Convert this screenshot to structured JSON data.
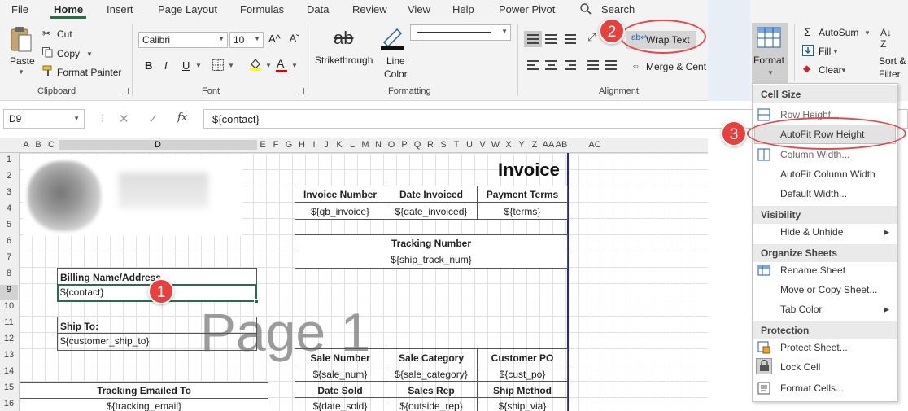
{
  "tabs": [
    "File",
    "Home",
    "Insert",
    "Page Layout",
    "Formulas",
    "Data",
    "Review",
    "View",
    "Help",
    "Power Pivot"
  ],
  "search": "Search",
  "clipboard": {
    "paste": "Paste",
    "cut": "Cut",
    "copy": "Copy",
    "format_painter": "Format Painter",
    "label": "Clipboard"
  },
  "font": {
    "name": "Calibri",
    "size": "10",
    "label": "Font",
    "bold": "B",
    "italic": "I",
    "underline": "U",
    "grow": "A^",
    "shrink": "Aˇ",
    "fill_color": "#ffff00",
    "font_color": "#e00000"
  },
  "formatting": {
    "strikethrough": "Strikethrough",
    "line_color": "Line\nColor",
    "label": "Formatting"
  },
  "alignment": {
    "wrap_text": "Wrap Text",
    "merge_center": "Merge & Cent",
    "label": "Alignment"
  },
  "cells": {
    "format": "Format"
  },
  "editing": {
    "autosum": "AutoSum",
    "fill": "Fill",
    "clear": "Clear",
    "sort_filter": "Sort &\nFilter"
  },
  "formula_bar": {
    "name_box": "D9",
    "content": "${contact}",
    "fx": "fx"
  },
  "columns": [
    "A",
    "B",
    "C",
    "D",
    "E",
    "F",
    "G",
    "H",
    "I",
    "J",
    "K",
    "L",
    "M",
    "N",
    "O",
    "P",
    "Q",
    "R",
    "S",
    "T",
    "U",
    "V",
    "W",
    "X",
    "Y",
    "Z",
    "AA",
    "AB",
    "AC"
  ],
  "rows": [
    "1",
    "2",
    "3",
    "4",
    "5",
    "6",
    "7",
    "8",
    "9",
    "10",
    "11",
    "12",
    "13",
    "14",
    "15",
    "16"
  ],
  "sheet": {
    "invoice_title": "Invoice",
    "invoice_number_label": "Invoice Number",
    "date_invoiced_label": "Date Invoiced",
    "payment_terms_label": "Payment Terms",
    "invoice_number_val": "${qb_invoice}",
    "date_invoiced_val": "${date_invoiced}",
    "payment_terms_val": "${terms}",
    "tracking_number_label": "Tracking Number",
    "tracking_number_val": "${ship_track_num}",
    "billing_label": "Billing Name/Address",
    "billing_val": "${contact}",
    "ship_to_label": "Ship To:",
    "ship_to_val": "${customer_ship_to}",
    "page_watermark": "Page 1",
    "sale_number_label": "Sale Number",
    "sale_category_label": "Sale Category",
    "customer_po_label": "Customer PO",
    "sale_number_val": "${sale_num}",
    "sale_category_val": "${sale_category}",
    "customer_po_val": "${cust_po}",
    "tracking_emailed_label": "Tracking Emailed To",
    "tracking_emailed_val": "${tracking_email}",
    "date_sold_label": "Date Sold",
    "sales_rep_label": "Sales Rep",
    "ship_method_label": "Ship Method",
    "date_sold_val": "${date_sold}",
    "sales_rep_val": "${outside_rep}",
    "ship_method_val": "${ship_via}"
  },
  "menu": {
    "cell_size": "Cell Size",
    "row_height": "Row Height...",
    "autofit_row": "AutoFit Row Height",
    "column_width": "Column Width...",
    "autofit_col": "AutoFit Column Width",
    "default_width": "Default Width...",
    "visibility": "Visibility",
    "hide_unhide": "Hide & Unhide",
    "organize": "Organize Sheets",
    "rename": "Rename Sheet",
    "move_copy": "Move or Copy Sheet...",
    "tab_color": "Tab Color",
    "protection": "Protection",
    "protect_sheet": "Protect Sheet...",
    "lock_cell": "Lock Cell",
    "format_cells": "Format Cells..."
  },
  "callouts": [
    "1",
    "2",
    "3"
  ],
  "colors": {
    "accent_green": "#217346",
    "callout_red": "#e8403c",
    "selection_green": "#217346",
    "print_border_blue": "#1f1fd0"
  }
}
